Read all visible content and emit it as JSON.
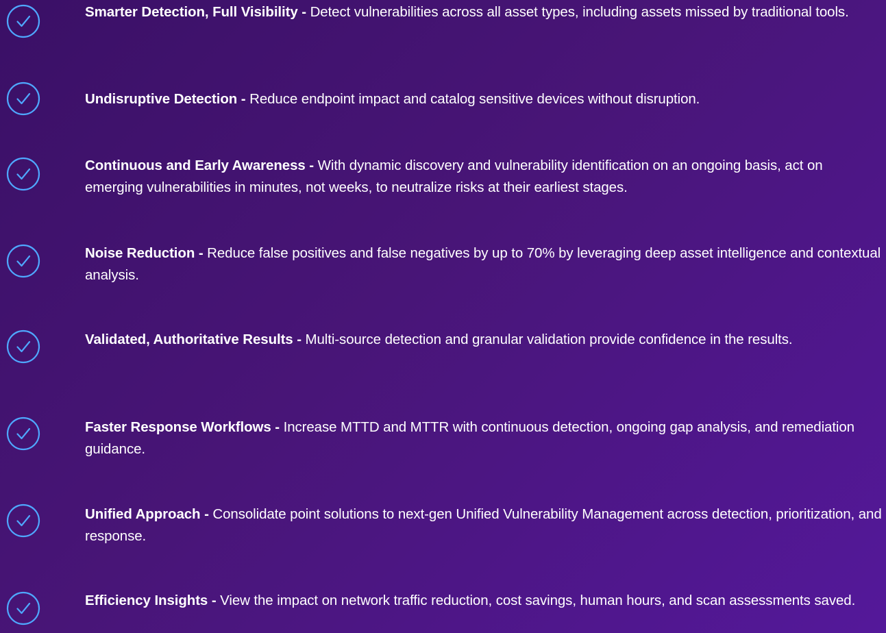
{
  "features": [
    {
      "icon": "check-circle-icon",
      "title": "Smarter Detection, Full Visibility - ",
      "description": "Detect vulnerabilities across all asset types, including assets missed by traditional tools."
    },
    {
      "icon": "check-circle-icon",
      "title": "Undisruptive Detection - ",
      "description": "Reduce endpoint impact and catalog sensitive devices without disruption."
    },
    {
      "icon": "check-circle-icon",
      "title": "Continuous and Early Awareness - ",
      "description": " With dynamic discovery and vulnerability identification on an ongoing basis, act on emerging vulnerabilities in minutes, not weeks, to neutralize risks at their earliest stages."
    },
    {
      "icon": "check-circle-icon",
      "title": "Noise Reduction - ",
      "description": "Reduce false positives and false negatives by up to 70% by leveraging deep asset intelligence and contextual analysis."
    },
    {
      "icon": "check-circle-icon",
      "title": "Validated, Authoritative Results - ",
      "description": "Multi-source detection and granular validation provide confidence in the results."
    },
    {
      "icon": "check-circle-icon",
      "title": "Faster Response Workflows - ",
      "description": "Increase MTTD and MTTR with continuous detection, ongoing gap analysis, and remediation guidance."
    },
    {
      "icon": "check-circle-icon",
      "title": "Unified Approach - ",
      "description": "Consolidate point solutions to next-gen Unified Vulnerability Management across detection, prioritization, and response."
    },
    {
      "icon": "check-circle-icon",
      "title": "Efficiency Insights - ",
      "description": "View the impact on network traffic reduction, cost savings, human hours, and scan assessments saved."
    }
  ],
  "colors": {
    "background_start": "#3a1066",
    "background_end": "#54189a",
    "icon_accent": "#4fa8ff",
    "text": "#ffffff"
  }
}
